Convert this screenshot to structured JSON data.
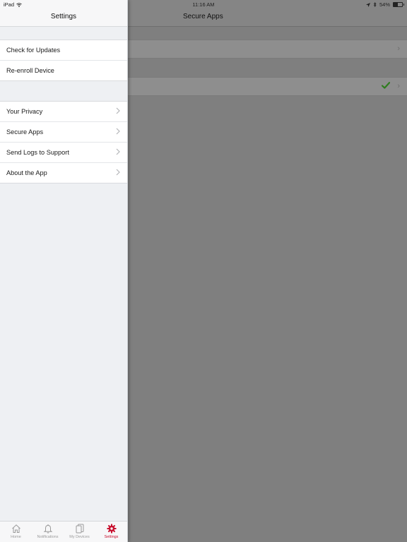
{
  "status_bar": {
    "device": "iPad",
    "time": "11:16 AM",
    "battery": "54%",
    "battery_level": 0.54
  },
  "main": {
    "title": "Secure Apps"
  },
  "sidebar": {
    "title": "Settings",
    "group1": [
      {
        "label": "Check for Updates"
      },
      {
        "label": "Re-enroll Device"
      }
    ],
    "group2": [
      {
        "label": "Your Privacy"
      },
      {
        "label": "Secure Apps"
      },
      {
        "label": "Send Logs to Support"
      },
      {
        "label": "About the App"
      }
    ]
  },
  "tabbar": {
    "tabs": [
      {
        "label": "Home",
        "icon": "home-icon"
      },
      {
        "label": "Notifications",
        "icon": "bell-icon"
      },
      {
        "label": "My Devices",
        "icon": "devices-icon"
      },
      {
        "label": "Settings",
        "icon": "gear-icon",
        "active": true
      }
    ]
  },
  "colors": {
    "accent": "#c8102e",
    "check": "#2f7d1f"
  }
}
